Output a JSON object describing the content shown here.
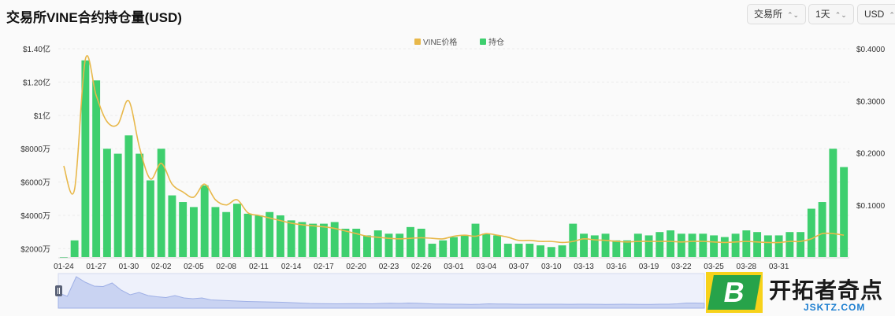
{
  "header": {
    "title": "交易所VINE合约持仓量(USD)",
    "exchange_select": "交易所",
    "interval_select": "1天",
    "currency_select": "USD"
  },
  "chart_data": {
    "type": "bar",
    "title": "交易所VINE合约持仓量(USD)",
    "legend": {
      "placement": "top-center",
      "items": [
        {
          "name": "VINE价格",
          "color": "#e8b84a"
        },
        {
          "name": "持仓",
          "color": "#3ecf6e"
        }
      ]
    },
    "x_tick_labels": [
      "01-24",
      "01-27",
      "01-30",
      "02-02",
      "02-05",
      "02-08",
      "02-11",
      "02-14",
      "02-17",
      "02-20",
      "02-23",
      "02-26",
      "03-01",
      "03-04",
      "03-07",
      "03-10",
      "03-13",
      "03-16",
      "03-19",
      "03-22",
      "03-25",
      "03-28",
      "03-31"
    ],
    "y_left_ticks": [
      "$2000万",
      "$4000万",
      "$6000万",
      "$8000万",
      "$1亿",
      "$1.20亿",
      "$1.40亿"
    ],
    "y_right_ticks": [
      "$0.1000",
      "$0.2000",
      "$0.3000",
      "$0.4000"
    ],
    "y_left_range": [
      15000000,
      140000000
    ],
    "y_right_range": [
      0,
      0.4
    ],
    "grid": "horizontal",
    "series": [
      {
        "name": "持仓",
        "axis": "left",
        "kind": "bar",
        "color": "#3ecf6e",
        "values": [
          15000000,
          25000000,
          133000000,
          121000000,
          80000000,
          77000000,
          88000000,
          77000000,
          61000000,
          80000000,
          52000000,
          48000000,
          45000000,
          58000000,
          45000000,
          42000000,
          47000000,
          41000000,
          40000000,
          42000000,
          40000000,
          37000000,
          36000000,
          35000000,
          35000000,
          36000000,
          32000000,
          32000000,
          28000000,
          31000000,
          29000000,
          29000000,
          33000000,
          32000000,
          23000000,
          25000000,
          27000000,
          28000000,
          35000000,
          29000000,
          28000000,
          23000000,
          23000000,
          23000000,
          22000000,
          21000000,
          22000000,
          35000000,
          29000000,
          28000000,
          29000000,
          25000000,
          25000000,
          29000000,
          28000000,
          30000000,
          31000000,
          29000000,
          29000000,
          29000000,
          28000000,
          27000000,
          29000000,
          31000000,
          30000000,
          28000000,
          28000000,
          30000000,
          30000000,
          44000000,
          48000000,
          80000000,
          69000000
        ]
      },
      {
        "name": "VINE价格",
        "axis": "right",
        "kind": "line",
        "color": "#e8b84a",
        "values": [
          0.175,
          0.13,
          0.38,
          0.31,
          0.26,
          0.255,
          0.3,
          0.21,
          0.15,
          0.18,
          0.14,
          0.125,
          0.115,
          0.14,
          0.11,
          0.1,
          0.11,
          0.085,
          0.08,
          0.075,
          0.07,
          0.065,
          0.062,
          0.06,
          0.058,
          0.055,
          0.05,
          0.045,
          0.04,
          0.038,
          0.036,
          0.035,
          0.036,
          0.037,
          0.036,
          0.035,
          0.04,
          0.042,
          0.04,
          0.045,
          0.042,
          0.038,
          0.032,
          0.032,
          0.03,
          0.03,
          0.028,
          0.03,
          0.035,
          0.033,
          0.032,
          0.03,
          0.029,
          0.03,
          0.03,
          0.03,
          0.03,
          0.029,
          0.03,
          0.03,
          0.029,
          0.028,
          0.029,
          0.03,
          0.029,
          0.028,
          0.028,
          0.03,
          0.03,
          0.035,
          0.045,
          0.045,
          0.042
        ]
      }
    ]
  },
  "watermark": {
    "logo_letter": "B",
    "name": "开拓者奇点",
    "url": "JSKTZ.COM"
  }
}
